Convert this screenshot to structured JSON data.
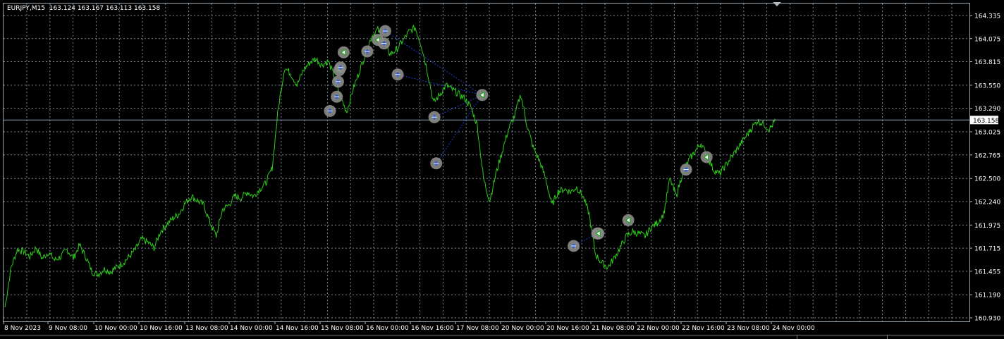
{
  "chart_header": {
    "symbol_timeframe": "EURJPY,M15",
    "ohlc": "163.124 163.167 163.113 163.158"
  },
  "colors": {
    "background": "#000000",
    "grid": "#7a8a96",
    "price_line": "#2ecc1a",
    "current_price_line": "#8aa4b8",
    "trade_link": "#1f3bd1",
    "trade_marker_ring": "#8c8c88",
    "buy_marker": "#2c5be0",
    "sell_marker": "#1fa81f"
  },
  "chart_data": {
    "type": "line",
    "symbol": "EURJPY",
    "timeframe": "M15",
    "ylim": [
      160.93,
      164.4
    ],
    "y_ticks": [
      "164.335",
      "164.075",
      "163.815",
      "163.550",
      "163.290",
      "163.025",
      "162.765",
      "162.500",
      "162.240",
      "161.975",
      "161.715",
      "161.455",
      "161.190",
      "160.930"
    ],
    "y_tick_values": [
      164.335,
      164.075,
      163.815,
      163.55,
      163.29,
      163.025,
      162.765,
      162.5,
      162.24,
      161.975,
      161.715,
      161.455,
      161.19,
      160.93
    ],
    "x_ticks": [
      "8 Nov 2023",
      "9 Nov 08:00",
      "10 Nov 00:00",
      "10 Nov 16:00",
      "13 Nov 08:00",
      "14 Nov 00:00",
      "14 Nov 16:00",
      "15 Nov 08:00",
      "16 Nov 00:00",
      "16 Nov 16:00",
      "17 Nov 08:00",
      "20 Nov 00:00",
      "20 Nov 16:00",
      "21 Nov 08:00",
      "22 Nov 00:00",
      "22 Nov 16:00",
      "23 Nov 08:00",
      "24 Nov 00:00"
    ],
    "current_price": "163.158",
    "series": [
      {
        "values": [
          161.05,
          161.5,
          161.7,
          161.68,
          161.62,
          161.72,
          161.6,
          161.67,
          161.58,
          161.62,
          161.7,
          161.6,
          161.75,
          161.62,
          161.45,
          161.42,
          161.48,
          161.45,
          161.5,
          161.55,
          161.62,
          161.7,
          161.82,
          161.78,
          161.72,
          161.9,
          161.98,
          162.05,
          162.1,
          162.22,
          162.3,
          162.25,
          162.2,
          162.0,
          161.85,
          162.15,
          162.2,
          162.3,
          162.28,
          162.35,
          162.3,
          162.38,
          162.45,
          162.62,
          163.3,
          163.75,
          163.68,
          163.55,
          163.72,
          163.8,
          163.85,
          163.78,
          163.82,
          163.65,
          163.42,
          163.25,
          163.5,
          163.7,
          163.9,
          164.1,
          164.18,
          164.0,
          163.9,
          163.95,
          164.05,
          164.15,
          164.2,
          164.0,
          163.7,
          163.35,
          163.45,
          163.55,
          163.5,
          163.45,
          163.4,
          163.3,
          163.1,
          162.5,
          162.25,
          162.55,
          162.8,
          163.05,
          163.2,
          163.45,
          163.1,
          162.85,
          162.7,
          162.5,
          162.2,
          162.35,
          162.38,
          162.35,
          162.4,
          162.3,
          162.1,
          161.65,
          161.55,
          161.5,
          161.6,
          161.72,
          161.85,
          161.9,
          161.88,
          161.85,
          161.95,
          162.0,
          162.1,
          162.5,
          162.3,
          162.55,
          162.7,
          162.8,
          162.9,
          162.75,
          162.6,
          162.55,
          162.65,
          162.75,
          162.85,
          162.95,
          163.05,
          163.15,
          163.12,
          163.05,
          163.158
        ],
        "x_range_days": [
          0,
          16.3
        ]
      }
    ],
    "trade_markers": [
      {
        "kind": "buy",
        "time_index": 52.3,
        "price": 163.26
      },
      {
        "kind": "buy",
        "time_index": 53.4,
        "price": 163.42
      },
      {
        "kind": "buy",
        "time_index": 53.6,
        "price": 163.59
      },
      {
        "kind": "sell",
        "time_index": 53.8,
        "price": 163.72
      },
      {
        "kind": "buy",
        "time_index": 54.0,
        "price": 163.75
      },
      {
        "kind": "sell",
        "time_index": 54.5,
        "price": 163.92
      },
      {
        "kind": "buy",
        "time_index": 58.3,
        "price": 163.93
      },
      {
        "kind": "sell",
        "time_index": 60.0,
        "price": 164.06
      },
      {
        "kind": "buy",
        "time_index": 61.0,
        "price": 164.02
      },
      {
        "kind": "buy",
        "time_index": 61.2,
        "price": 164.16
      },
      {
        "kind": "buy",
        "time_index": 63.2,
        "price": 163.67
      },
      {
        "kind": "buy",
        "time_index": 69.1,
        "price": 163.19
      },
      {
        "kind": "buy",
        "time_index": 69.4,
        "price": 162.67
      },
      {
        "kind": "sell",
        "time_index": 76.8,
        "price": 163.44
      },
      {
        "kind": "buy",
        "time_index": 91.5,
        "price": 161.74
      },
      {
        "kind": "buy",
        "time_index": 95.3,
        "price": 161.88
      },
      {
        "kind": "sell",
        "time_index": 95.5,
        "price": 161.88
      },
      {
        "kind": "sell",
        "time_index": 100.3,
        "price": 162.03
      },
      {
        "kind": "buy",
        "time_index": 109.6,
        "price": 162.6
      },
      {
        "kind": "sell",
        "time_index": 112.9,
        "price": 162.74
      }
    ],
    "trade_links": [
      [
        9,
        13
      ],
      [
        10,
        13
      ],
      [
        11,
        13
      ],
      [
        12,
        13
      ],
      [
        14,
        15
      ]
    ]
  }
}
